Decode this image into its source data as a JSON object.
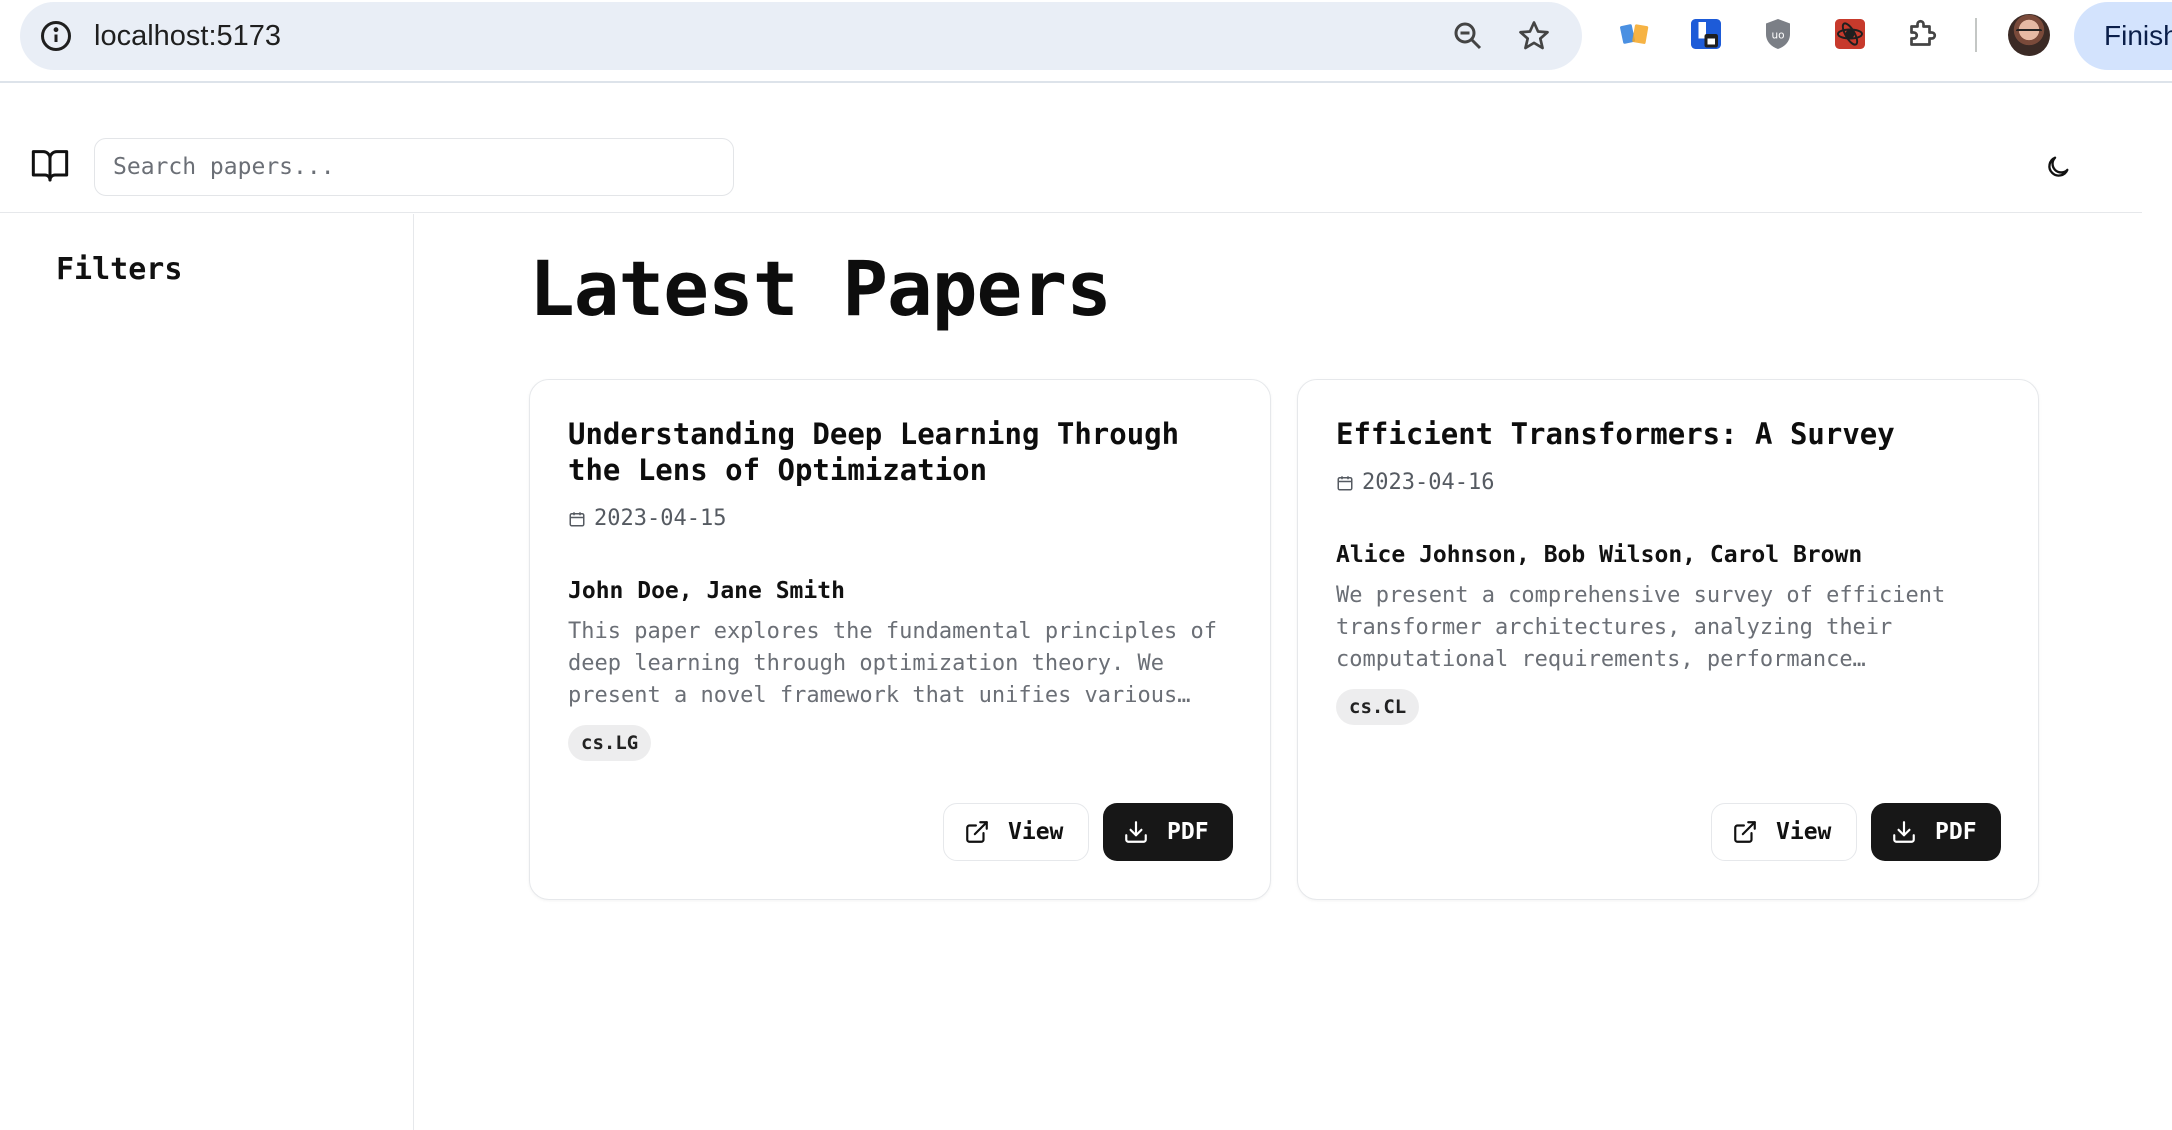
{
  "browser": {
    "url": "localhost:5173",
    "finish_label": "Finish"
  },
  "header": {
    "search_placeholder": "Search papers..."
  },
  "sidebar": {
    "title": "Filters"
  },
  "main": {
    "title": "Latest Papers",
    "papers": [
      {
        "title": "Understanding Deep Learning Through the Lens of Optimization",
        "date": "2023-04-15",
        "authors": "John Doe, Jane Smith",
        "abstract": "This paper explores the fundamental principles of deep learning through optimization theory. We present a novel framework that unifies various…",
        "tag": "cs.LG",
        "view_label": "View",
        "pdf_label": "PDF"
      },
      {
        "title": "Efficient Transformers: A Survey",
        "date": "2023-04-16",
        "authors": "Alice Johnson, Bob Wilson, Carol Brown",
        "abstract": "We present a comprehensive survey of efficient transformer architectures, analyzing their computational requirements, performance…",
        "tag": "cs.CL",
        "view_label": "View",
        "pdf_label": "PDF"
      }
    ]
  },
  "colors": {
    "omnibox_bg": "#e9eef6",
    "finish_bg": "#d3e3fd",
    "pdf_button_bg": "#171717",
    "tag_bg": "#ededee"
  },
  "icons": {
    "browser": [
      "info-icon",
      "zoom-out-icon",
      "bookmark-star-icon",
      "extension-icon",
      "puzzle-icon"
    ],
    "app": [
      "book-open-icon",
      "moon-icon",
      "calendar-icon",
      "external-link-icon",
      "download-icon"
    ]
  }
}
